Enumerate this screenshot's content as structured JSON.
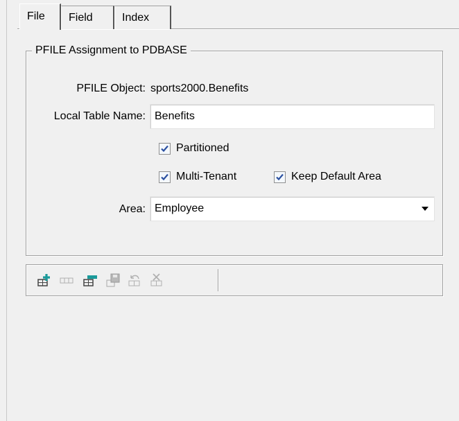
{
  "tabs": [
    {
      "label": "File",
      "active": true
    },
    {
      "label": "Field",
      "active": false
    },
    {
      "label": "Index",
      "active": false
    }
  ],
  "group": {
    "title": "PFILE Assignment to PDBASE"
  },
  "form": {
    "pfile_object_label": "PFILE Object:",
    "pfile_object_value": "sports2000.Benefits",
    "local_table_label": "Local Table Name:",
    "local_table_value": "Benefits",
    "partitioned_label": "Partitioned",
    "partitioned_checked": true,
    "multi_tenant_label": "Multi-Tenant",
    "multi_tenant_checked": true,
    "keep_default_area_label": "Keep Default Area",
    "keep_default_area_checked": true,
    "area_label": "Area:",
    "area_value": "Employee"
  },
  "toolbar": {
    "buttons": [
      {
        "icon": "add-row-icon",
        "enabled": true
      },
      {
        "icon": "grid-icon",
        "enabled": false
      },
      {
        "icon": "remove-row-icon",
        "enabled": true
      },
      {
        "icon": "save-icon",
        "enabled": false
      },
      {
        "icon": "undo-icon",
        "enabled": false
      },
      {
        "icon": "delete-icon",
        "enabled": false
      }
    ]
  },
  "colors": {
    "background": "#f0f0f0",
    "check_mark": "#2a4fa0",
    "add_accent": "#1a9a9a"
  }
}
